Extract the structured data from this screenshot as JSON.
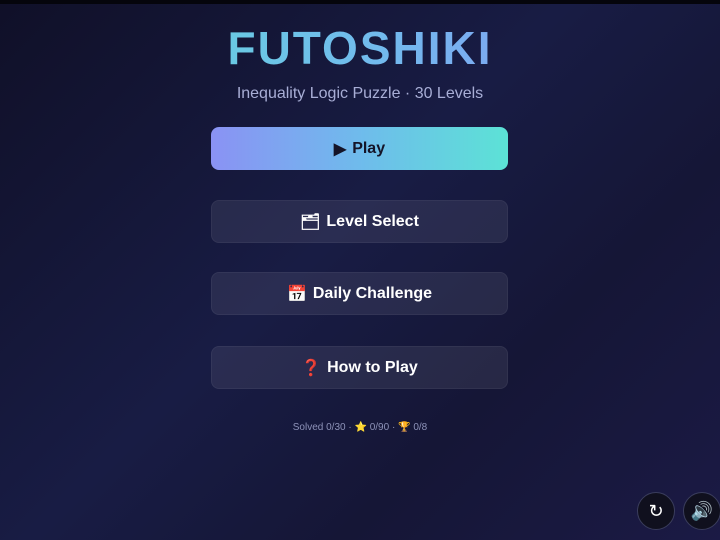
{
  "app": {
    "title": "FUTOSHIKI",
    "subtitle": "Inequality Logic Puzzle · 30 Levels"
  },
  "menu": {
    "play": {
      "icon": "▶",
      "label": "Play"
    },
    "level_select": {
      "icon": "🗂",
      "label": "Level Select"
    },
    "daily_challenge": {
      "icon": "📅",
      "label": "Daily Challenge"
    },
    "how_to_play": {
      "icon": "❓",
      "label": "How to Play"
    }
  },
  "stats": {
    "solved": "Solved 0/30",
    "separator": "·",
    "stars_icon": "⭐",
    "stars": "0/90",
    "trophy_icon": "🏆",
    "trophies": "0/8"
  },
  "controls": {
    "restart_icon": "↻",
    "sound_icon": "🔊"
  },
  "colors": {
    "accent_start": "#8a92f4",
    "accent_end": "#5ce2d6",
    "background": "#151636"
  }
}
